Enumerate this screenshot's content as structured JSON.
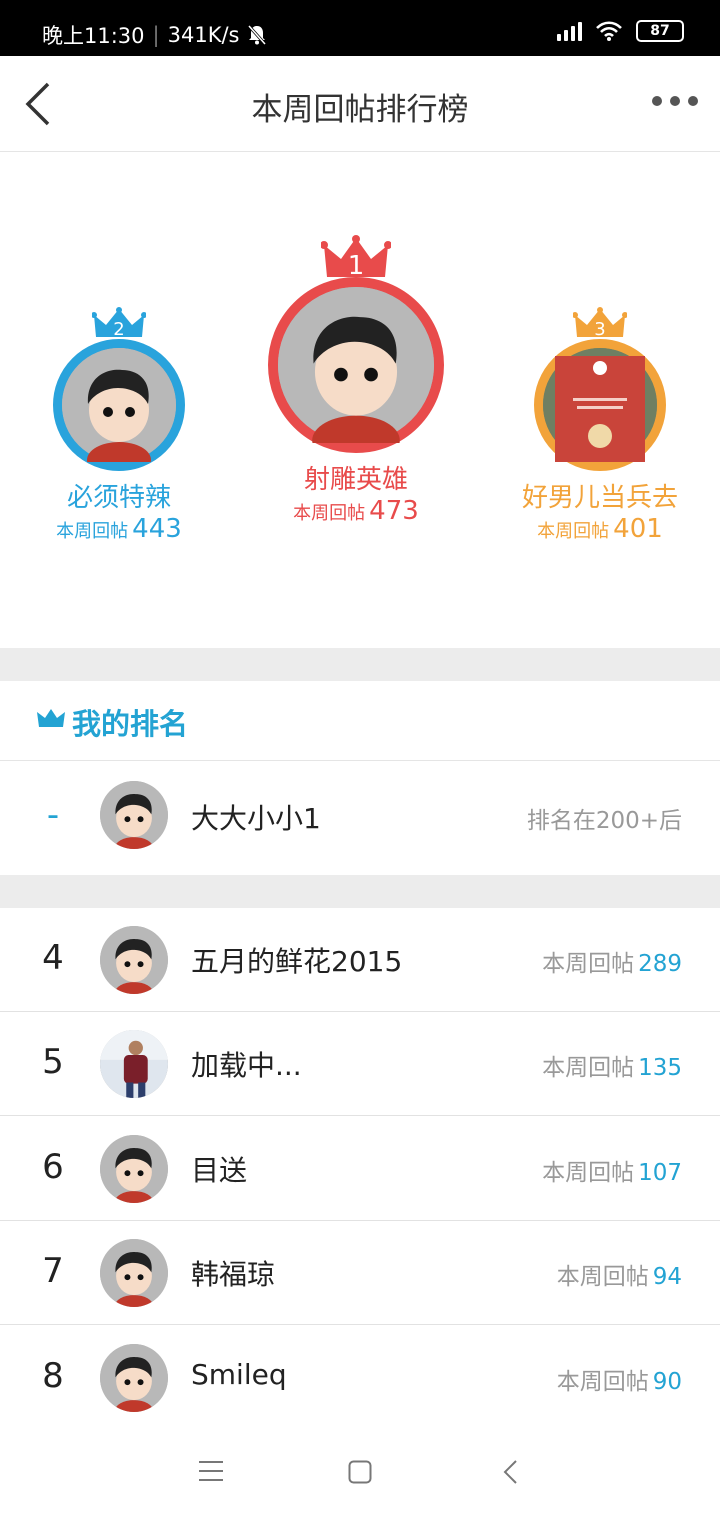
{
  "status": {
    "time": "晚上11:30",
    "speed": "341K/s",
    "battery": "87"
  },
  "nav": {
    "title": "本周回帖排行榜"
  },
  "colors": {
    "accent": "#23a3d3",
    "first": "#e84b4b",
    "second": "#29a3dc",
    "third": "#f2a33a"
  },
  "podium": {
    "first": {
      "rank": "1",
      "name": "射雕英雄",
      "stat_label": "本周回帖",
      "stat_value": "473"
    },
    "second": {
      "rank": "2",
      "name": "必须特辣",
      "stat_label": "本周回帖",
      "stat_value": "443"
    },
    "third": {
      "rank": "3",
      "name": "好男儿当兵去",
      "stat_label": "本周回帖",
      "stat_value": "401"
    }
  },
  "my_rank": {
    "title": "我的排名",
    "rank": "-",
    "name": "大大小小1",
    "note": "排名在200+后"
  },
  "list": [
    {
      "rank": "4",
      "name": "五月的鲜花2015",
      "label": "本周回帖",
      "value": "289"
    },
    {
      "rank": "5",
      "name": "加载中...",
      "label": "本周回帖",
      "value": "135"
    },
    {
      "rank": "6",
      "name": "目送",
      "label": "本周回帖",
      "value": "107"
    },
    {
      "rank": "7",
      "name": "韩福琼",
      "label": "本周回帖",
      "value": "94"
    },
    {
      "rank": "8",
      "name": "Smileq",
      "label": "本周回帖",
      "value": "90"
    }
  ]
}
